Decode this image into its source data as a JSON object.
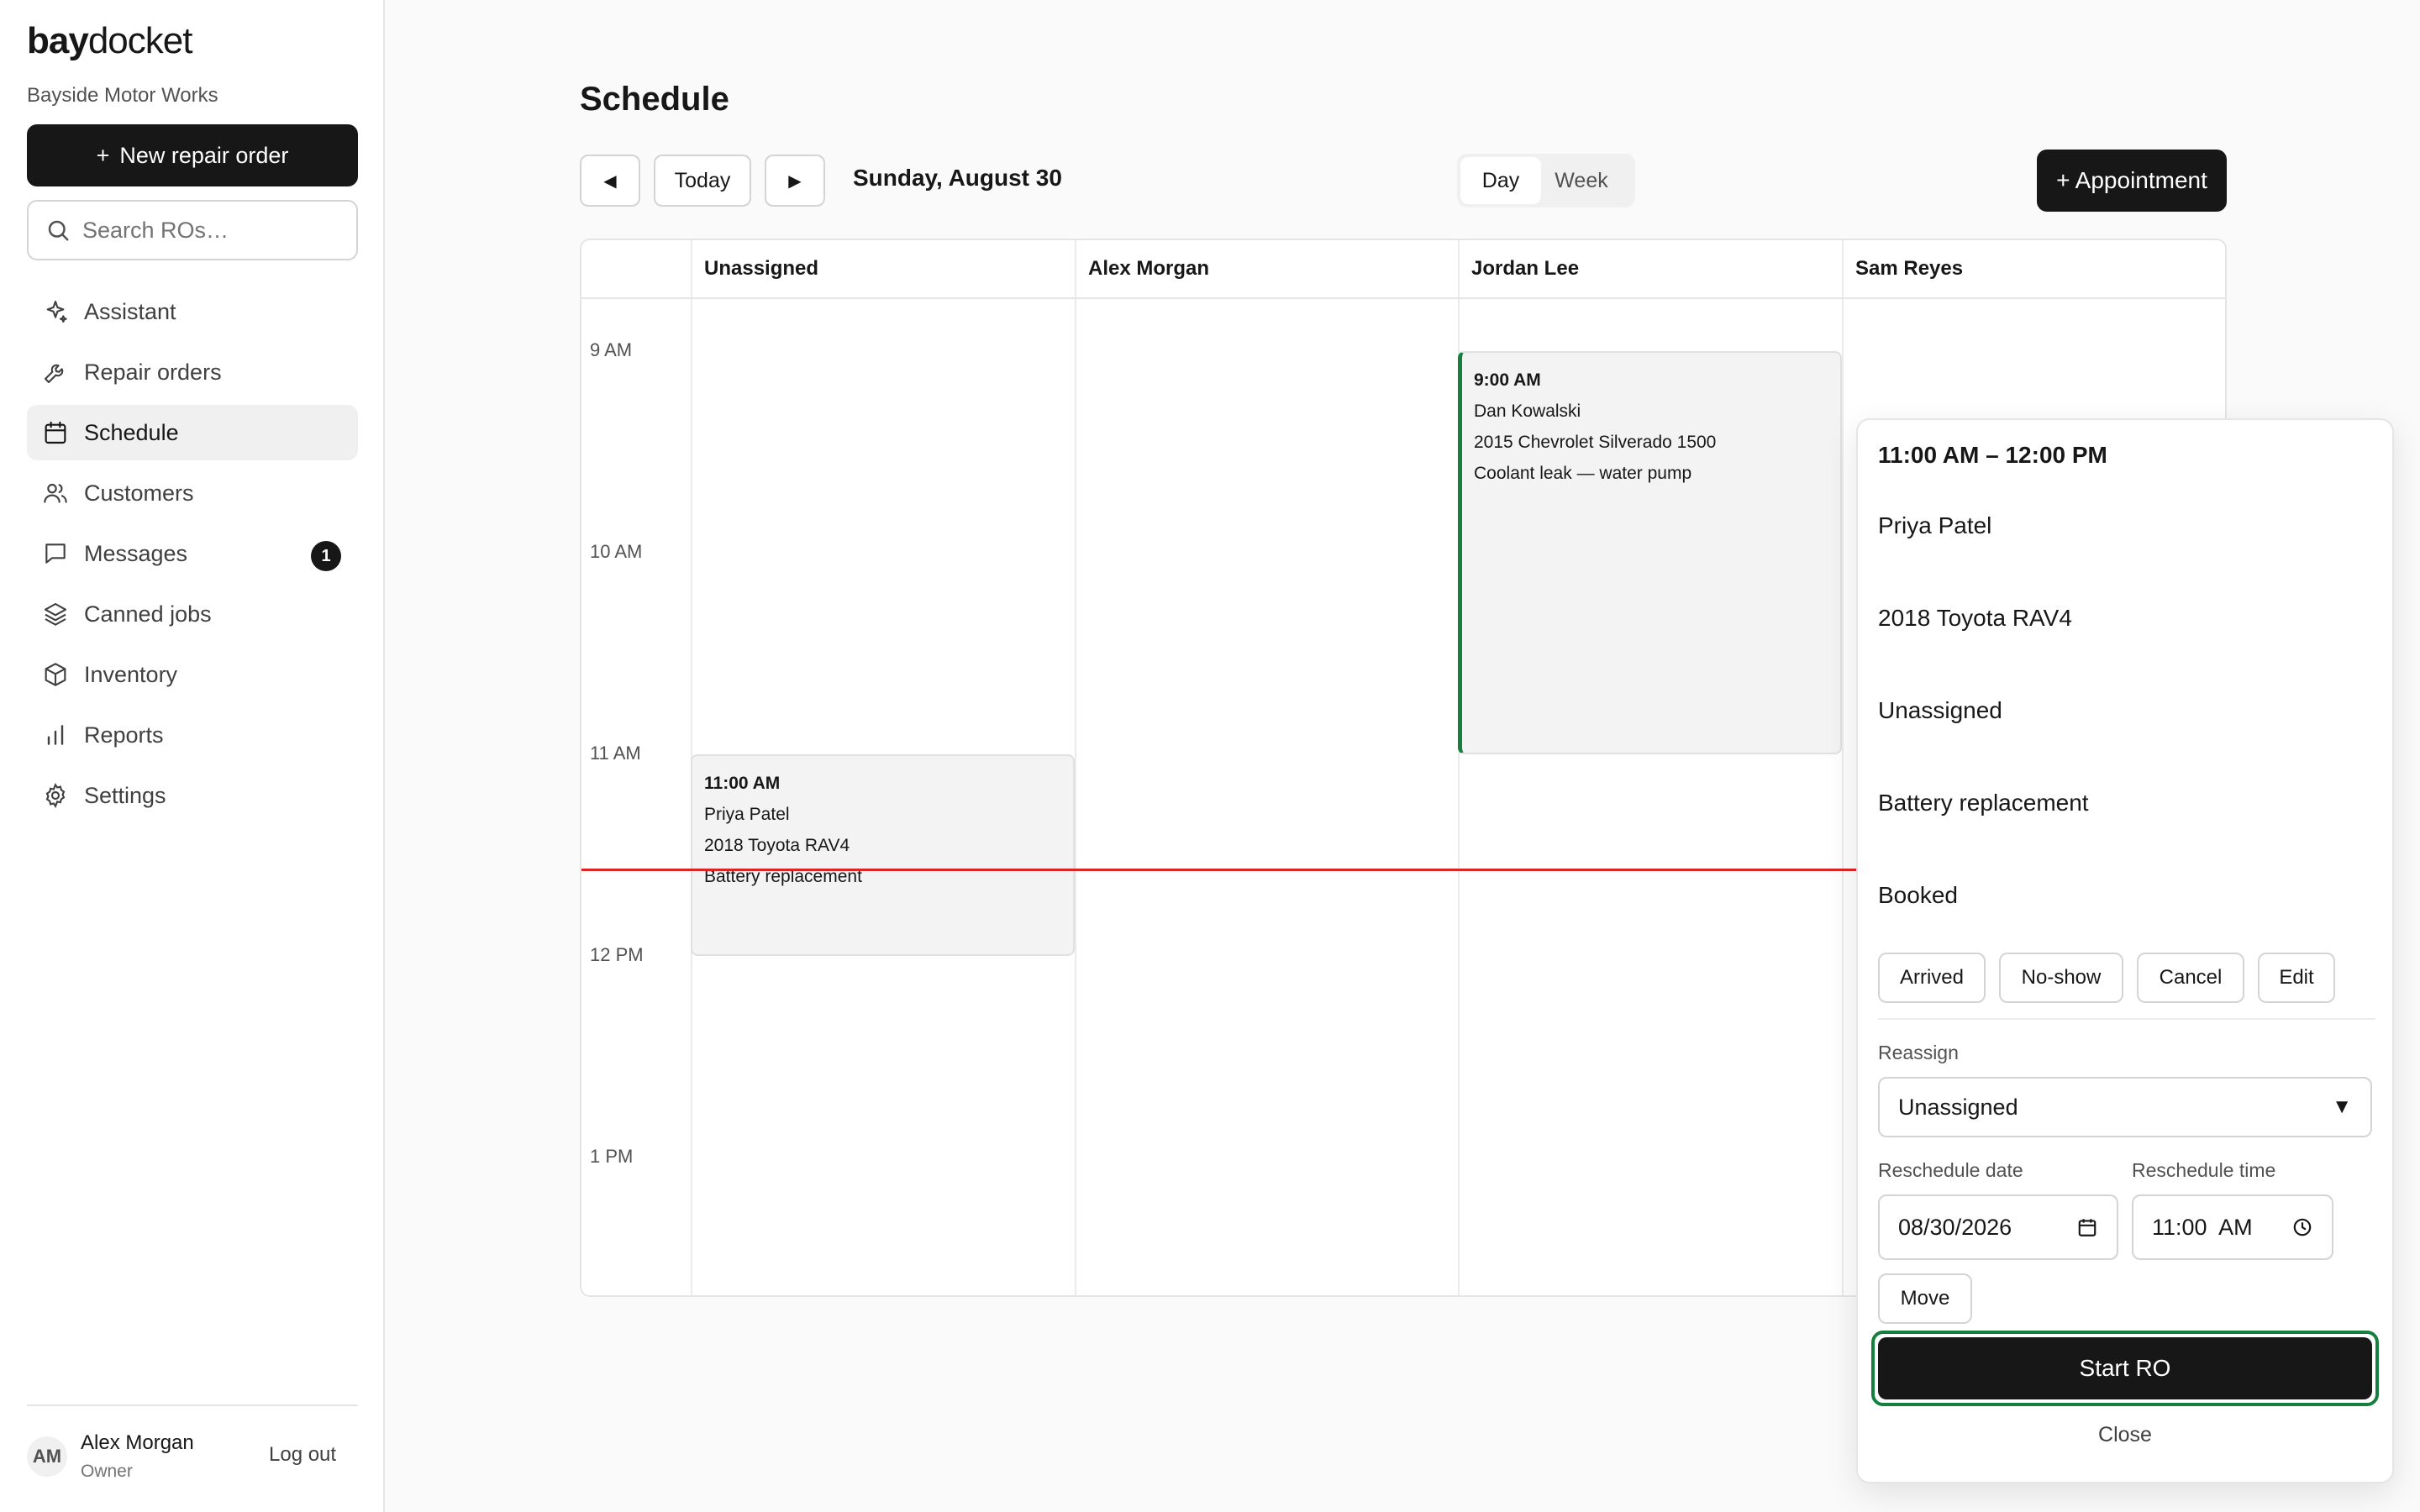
{
  "brand": {
    "bold": "bay",
    "light": "docket",
    "shop": "Bayside Motor Works"
  },
  "sidebar": {
    "new_ro": "New repair order",
    "search_placeholder": "Search ROs…",
    "items": [
      {
        "label": "Assistant",
        "icon": "sparkles-icon"
      },
      {
        "label": "Repair orders",
        "icon": "wrench-icon"
      },
      {
        "label": "Schedule",
        "icon": "calendar-icon",
        "active": true
      },
      {
        "label": "Customers",
        "icon": "users-icon"
      },
      {
        "label": "Messages",
        "icon": "message-icon",
        "badge": "1"
      },
      {
        "label": "Canned jobs",
        "icon": "layers-icon"
      },
      {
        "label": "Inventory",
        "icon": "box-icon"
      },
      {
        "label": "Reports",
        "icon": "bar-chart-icon"
      },
      {
        "label": "Settings",
        "icon": "gear-icon"
      }
    ],
    "user": {
      "initials": "AM",
      "name": "Alex Morgan",
      "role": "Owner",
      "logout": "Log out"
    }
  },
  "main": {
    "title": "Schedule",
    "today": "Today",
    "date": "Sunday, August 30",
    "views": [
      "Day",
      "Week"
    ],
    "add_appointment": "+ Appointment"
  },
  "grid": {
    "columns": [
      "Unassigned",
      "Alex Morgan",
      "Jordan Lee",
      "Sam Reyes"
    ],
    "times": [
      "9 AM",
      "10 AM",
      "11 AM",
      "12 PM",
      "1 PM"
    ],
    "appointments": [
      {
        "time": "9:00 AM",
        "customer": "Dan Kowalski",
        "vehicle": "2015 Chevrolet Silverado 1500",
        "job": "Coolant leak — water pump"
      },
      {
        "time": "11:00 AM",
        "customer": "Priya Patel",
        "vehicle": "2018 Toyota RAV4",
        "job": "Battery replacement"
      }
    ]
  },
  "popover": {
    "time_range": "11:00 AM – 12:00 PM",
    "customer": "Priya Patel",
    "vehicle": "2018 Toyota RAV4",
    "tech": "Unassigned",
    "job": "Battery replacement",
    "status": "Booked",
    "actions": [
      "Arrived",
      "No-show",
      "Cancel",
      "Edit"
    ],
    "reassign_label": "Reassign",
    "reassign_value": "Unassigned",
    "date_label": "Reschedule date",
    "date_value": "08/30/2026",
    "time_label": "Reschedule time",
    "time_value": "11:00  AM",
    "move": "Move",
    "start_ro": "Start RO",
    "close": "Close"
  }
}
